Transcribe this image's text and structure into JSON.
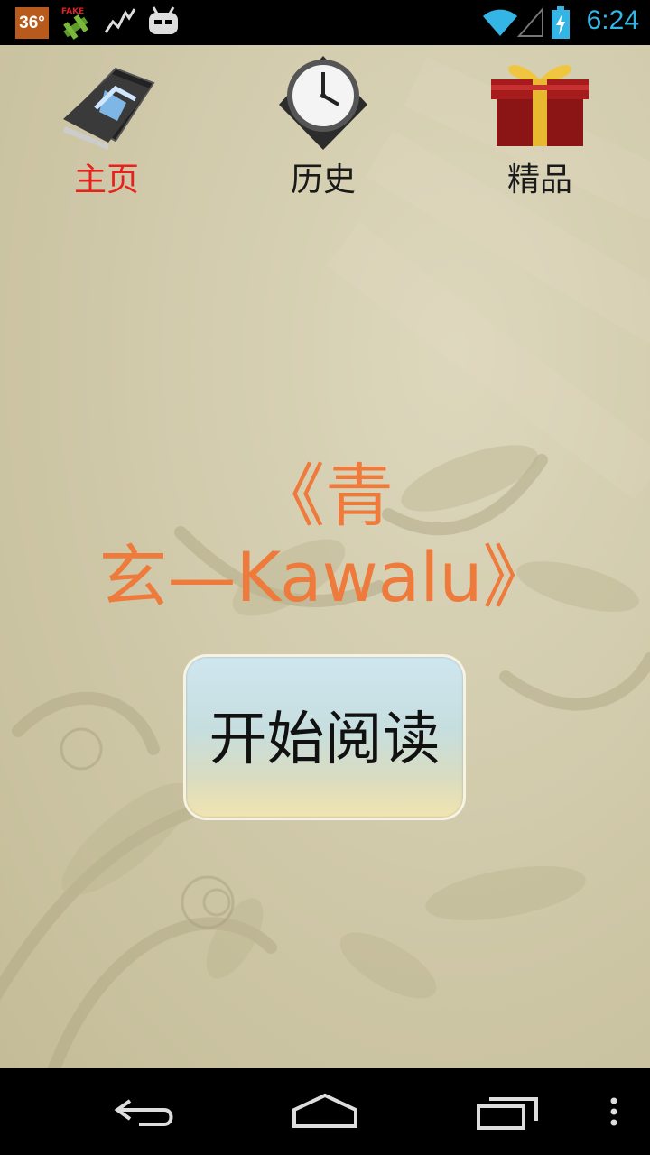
{
  "status_bar": {
    "badge": "36°",
    "icons": [
      "fake-gps-icon",
      "activity-graph-icon",
      "android-robot-icon",
      "wifi-icon",
      "cell-signal-icon",
      "battery-charging-icon"
    ],
    "time": "6:24",
    "fake_label": "FAKE"
  },
  "tabs": [
    {
      "label": "主页",
      "icon": "home-book-icon",
      "active": true
    },
    {
      "label": "历史",
      "icon": "clock-icon",
      "active": false
    },
    {
      "label": "精品",
      "icon": "gift-box-icon",
      "active": false
    }
  ],
  "main": {
    "book_title_line1": "《青",
    "book_title_line2": "玄—Kawalu》",
    "start_button": "开始阅读"
  },
  "nav_bar": {
    "icons": [
      "back-icon",
      "home-icon",
      "recent-apps-icon",
      "menu-icon"
    ]
  },
  "colors": {
    "accent": "#33b5e5",
    "active_tab": "#e8211c",
    "title": "#ee7a3c",
    "background": "#cfc8a8"
  }
}
